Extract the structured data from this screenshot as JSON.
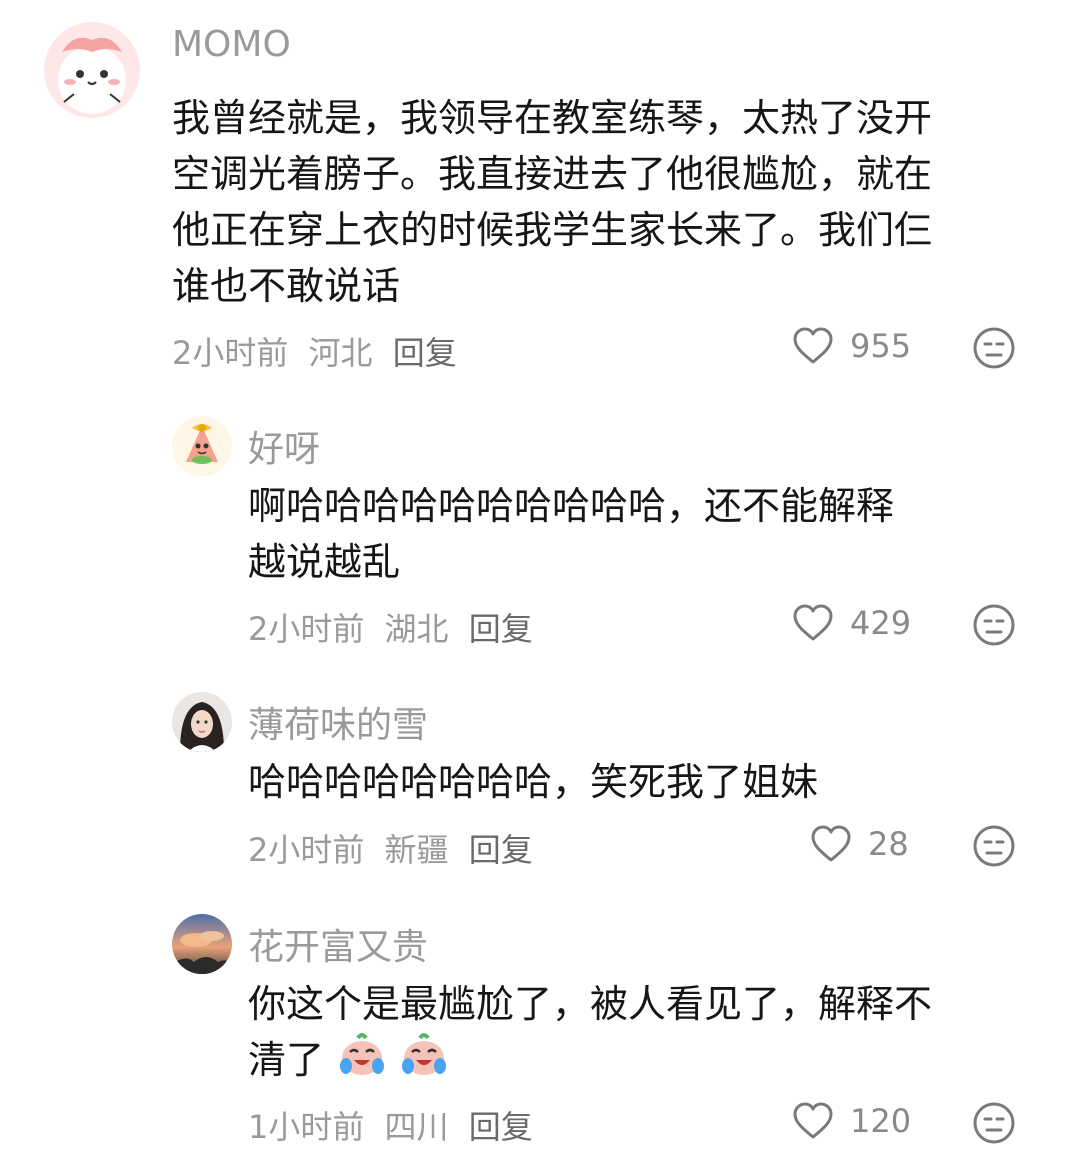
{
  "comments": [
    {
      "username": "MOMO",
      "avatar": "pink-cartoon-avatar",
      "text_lines": [
        "我曾经就是，我领导在教室练琴，太热了没开",
        "空调光着膀子。我直接进去了他很尴尬，就在",
        "他正在穿上衣的时候我学生家长来了。我们仨",
        "谁也不敢说话"
      ],
      "time": "2小时前",
      "location": "河北",
      "reply_label": "回复",
      "likes": "955"
    },
    {
      "username": "好呀",
      "avatar": "cartoon-starfish-avatar",
      "text_lines": [
        "啊哈哈哈哈哈哈哈哈哈哈，还不能解释",
        "越说越乱"
      ],
      "time": "2小时前",
      "location": "湖北",
      "reply_label": "回复",
      "likes": "429"
    },
    {
      "username": "薄荷味的雪",
      "avatar": "girl-photo-avatar",
      "text_lines": [
        "哈哈哈哈哈哈哈哈，笑死我了姐妹"
      ],
      "time": "2小时前",
      "location": "新疆",
      "reply_label": "回复",
      "likes": "28"
    },
    {
      "username": "花开富又贵",
      "avatar": "sunset-sky-avatar",
      "text_lines": [
        "你这个是最尴尬了，被人看见了，解释不",
        "清了"
      ],
      "text_emojis": [
        "crying-laughing-emoji",
        "crying-laughing-emoji"
      ],
      "time": "1小时前",
      "location": "四川",
      "reply_label": "回复",
      "likes": "120"
    }
  ],
  "colors": {
    "text": "#161616",
    "secondary": "#9a9a9a",
    "icon": "#7a7a7a"
  }
}
